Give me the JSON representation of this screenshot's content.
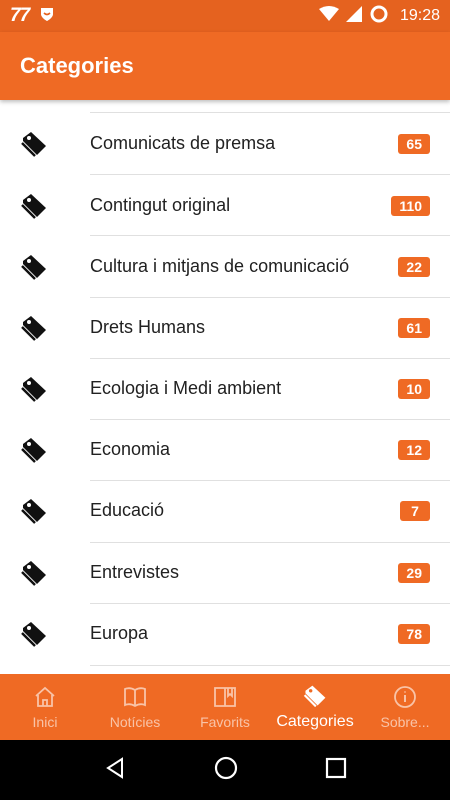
{
  "status_bar": {
    "notification_number": "77",
    "time": "19:28",
    "icons": [
      "shield-app-icon",
      "wifi-icon",
      "signal-icon",
      "battery-ring-icon"
    ]
  },
  "app_bar": {
    "title": "Categories"
  },
  "categories": [
    {
      "label": "Comunicats de premsa",
      "count": "65"
    },
    {
      "label": "Contingut original",
      "count": "110"
    },
    {
      "label": "Cultura i mitjans de comunicació",
      "count": "22"
    },
    {
      "label": "Drets Humans",
      "count": "61"
    },
    {
      "label": "Ecologia i Medi ambient",
      "count": "10"
    },
    {
      "label": "Economia",
      "count": "12"
    },
    {
      "label": "Educació",
      "count": "7"
    },
    {
      "label": "Entrevistes",
      "count": "29"
    },
    {
      "label": "Europa",
      "count": "78"
    }
  ],
  "bottom_nav": [
    {
      "label": "Inici",
      "icon": "home-icon"
    },
    {
      "label": "Notícies",
      "icon": "book-icon"
    },
    {
      "label": "Favorits",
      "icon": "bookmark-book-icon"
    },
    {
      "label": "Categories",
      "icon": "tag-icon",
      "active": true
    },
    {
      "label": "Sobre...",
      "icon": "info-icon"
    }
  ],
  "colors": {
    "accent": "#ef6a24",
    "status_bar": "#e5621f",
    "text": "#212121",
    "divider": "#e0e0e0"
  }
}
